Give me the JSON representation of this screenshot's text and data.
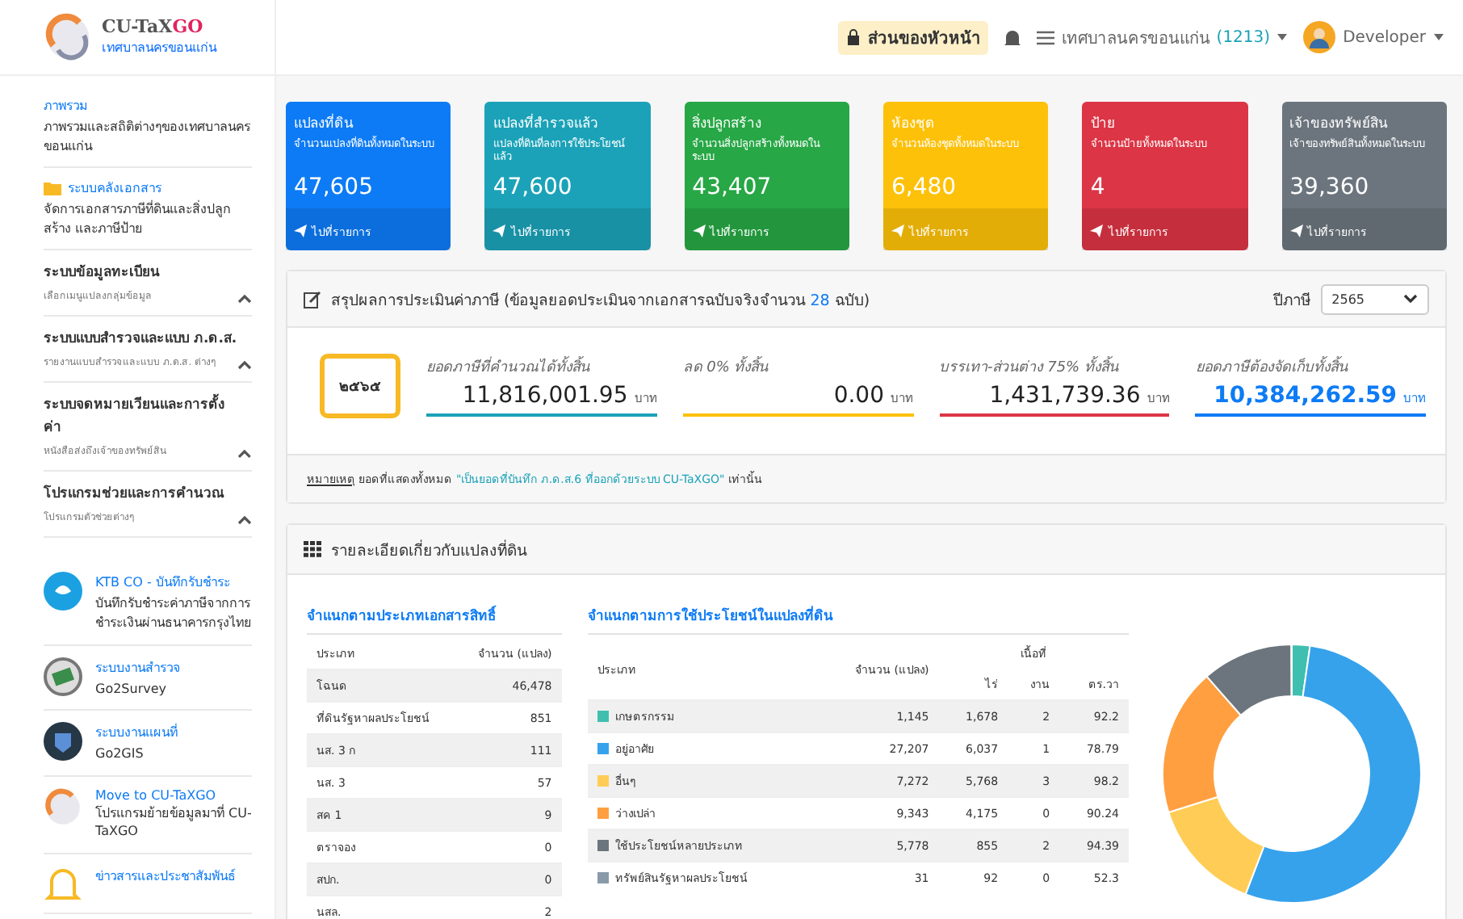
{
  "header": {
    "logo_title": "CU-TaX",
    "logo_title_accent": "GO",
    "logo_subtitle": "เทศบาลนครขอนแก่น",
    "role_badge": "ส่วนของหัวหน้า",
    "organization": "เทศบาลนครขอนแก่น",
    "organization_count": "(1213)",
    "user": "Developer"
  },
  "sidebar": {
    "items": [
      {
        "kind": "link",
        "title": "ภาพรวม",
        "subtitle": "ภาพรวมและสถิติต่างๆของเทศบาลนครขอนแก่น"
      },
      {
        "kind": "folder",
        "title": "ระบบคลังเอกสาร",
        "subtitle": "จัดการเอกสารภาษีที่ดินและสิ่งปลูกสร้าง และภาษีป้าย"
      },
      {
        "kind": "section",
        "title": "ระบบข้อมูลทะเบียน",
        "subtitle": "เลือกเมนูแปลงกลุ่มข้อมูล"
      },
      {
        "kind": "section",
        "title": "ระบบแบบสำรวจและแบบ ภ.ด.ส.",
        "subtitle": "รายงานแบบสำรวจและแบบ ภ.ด.ส. ต่างๆ"
      },
      {
        "kind": "section",
        "title": "ระบบจดหมายเวียนและการตั้งค่า",
        "subtitle": "หนังสือส่งถึงเจ้าของทรัพย์สิน"
      },
      {
        "kind": "section",
        "title": "โปรแกรมช่วยและการคำนวณ",
        "subtitle": "โปรแกรมตัวช่วยต่างๆ"
      }
    ],
    "apps": [
      {
        "kind": "bank",
        "title": "KTB CO - บันทึกรับชำระ",
        "subtitle": "บันทึกรับชำระค่าภาษีจากการชำระเงินผ่านธนาคารกรุงไทย"
      },
      {
        "kind": "survey",
        "title": "ระบบงานสำรวจ",
        "subtitle": "Go2Survey"
      },
      {
        "kind": "map",
        "title": "ระบบงานแผนที่",
        "subtitle": "Go2GIS"
      },
      {
        "kind": "logo",
        "title": "Move to CU-TaXGO",
        "subtitle": "โปรแกรมย้ายข้อมูลมาที่ CU-TaXGO"
      },
      {
        "kind": "bell",
        "title": "ข่าวสารและประชาสัมพันธ์"
      }
    ]
  },
  "stat_cards": [
    {
      "title": "แปลงที่ดิน",
      "subtitle": "จำนวนแปลงที่ดินทั้งหมดในระบบ",
      "value": "47,605",
      "link": "ไปที่รายการ",
      "color": "#0d7bf5"
    },
    {
      "title": "แปลงที่สำรวจแล้ว",
      "subtitle": "แปลงที่ดินที่ลงการใช้ประโยชน์แล้ว",
      "value": "47,600",
      "link": "ไปที่รายการ",
      "color": "#1ba2b8"
    },
    {
      "title": "สิ่งปลูกสร้าง",
      "subtitle": "จำนวนสิ่งปลูกสร้างทั้งหมดในระบบ",
      "value": "43,407",
      "link": "ไปที่รายการ",
      "color": "#27a745"
    },
    {
      "title": "ห้องชุด",
      "subtitle": "จำนวนห้องชุดทั้งหมดในระบบ",
      "value": "6,480",
      "link": "ไปที่รายการ",
      "color": "#fdc10a"
    },
    {
      "title": "ป้าย",
      "subtitle": "จำนวนป้ายทั้งหมดในระบบ",
      "value": "4",
      "link": "ไปที่รายการ",
      "color": "#dc3545"
    },
    {
      "title": "เจ้าของทรัพย์สิน",
      "subtitle": "เจ้าของทรัพย์สินทั้งหมดในระบบ",
      "value": "39,360",
      "link": "ไปที่รายการ",
      "color": "#6c757d"
    }
  ],
  "summary": {
    "title": "สรุปผลการประเมินค่าภาษี (ข้อมูลยอดประเมินจากเอกสารฉบับจริงจำนวน",
    "document_count": "28",
    "title_end": "ฉบับ)",
    "year_label": "ปีภาษี",
    "year": "2565",
    "year_badge": "๒๕๖๕",
    "figures": [
      {
        "label": "ยอดภาษีที่คำนวณได้ทั้งสิ้น",
        "value": "11,816,001.95",
        "unit": "บาท",
        "color": "#1ba2b8",
        "highlight": false
      },
      {
        "label": "ลด 0% ทั้งสิ้น",
        "value": "0.00",
        "unit": "บาท",
        "color": "#fdc10a",
        "highlight": false
      },
      {
        "label": "บรรเทา-ส่วนต่าง 75% ทั้งสิ้น",
        "value": "1,431,739.36",
        "unit": "บาท",
        "color": "#dc3545",
        "highlight": false
      },
      {
        "label": "ยอดภาษีต้องจัดเก็บทั้งสิ้น",
        "value": "10,384,262.59",
        "unit": "บาท",
        "color": "#0d7bf5",
        "highlight": true
      }
    ],
    "note_label": "หมายเหตุ",
    "note_text": "ยอดที่แสดงทั้งหมด",
    "note_quote": "\"เป็นยอดที่บันทึก ภ.ด.ส.6 ที่ออกด้วยระบบ CU-TaXGO\"",
    "note_end": "เท่านั้น"
  },
  "land_detail": {
    "title": "รายละเอียดเกี่ยวกับแปลงที่ดิน",
    "by_document": {
      "title": "จำแนกตามประเภทเอกสารสิทธิ์",
      "columns": [
        "ประเภท",
        "จำนวน (แปลง)"
      ],
      "rows": [
        [
          "โฉนด",
          "46,478"
        ],
        [
          "ที่ดินรัฐหาผลประโยชน์",
          "851"
        ],
        [
          "นส. 3 ก",
          "111"
        ],
        [
          "นส. 3",
          "57"
        ],
        [
          "สค 1",
          "9"
        ],
        [
          "ตราจอง",
          "0"
        ],
        [
          "สปก.",
          "0"
        ],
        [
          "นสล.",
          "2"
        ]
      ]
    },
    "by_use": {
      "title": "จำแนกตามการใช้ประโยชน์ในแปลงที่ดิน",
      "columns": [
        "ประเภท",
        "จำนวน (แปลง)"
      ],
      "area_heading": "เนื้อที่",
      "area_columns": [
        "ไร่",
        "งาน",
        "ตร.วา"
      ],
      "rows": [
        {
          "name": "เกษตรกรรม",
          "color": "#3fbfb0",
          "count": "1,145",
          "rai": "1,678",
          "ngan": "2",
          "wa": "92.2"
        },
        {
          "name": "อยู่อาศัย",
          "color": "#36a2eb",
          "count": "27,207",
          "rai": "6,037",
          "ngan": "1",
          "wa": "78.79"
        },
        {
          "name": "อื่นๆ",
          "color": "#ffcd56",
          "count": "7,272",
          "rai": "5,768",
          "ngan": "3",
          "wa": "98.2"
        },
        {
          "name": "ว่างเปล่า",
          "color": "#ff9f40",
          "count": "9,343",
          "rai": "4,175",
          "ngan": "0",
          "wa": "90.24"
        },
        {
          "name": "ใช้ประโยชน์หลายประเภท",
          "color": "#6c757d",
          "count": "5,778",
          "rai": "855",
          "ngan": "2",
          "wa": "94.39"
        },
        {
          "name": "ทรัพย์สินรัฐหาผลประโยชน์",
          "color": "#8a9aa8",
          "count": "31",
          "rai": "92",
          "ngan": "0",
          "wa": "52.3"
        }
      ]
    }
  }
}
